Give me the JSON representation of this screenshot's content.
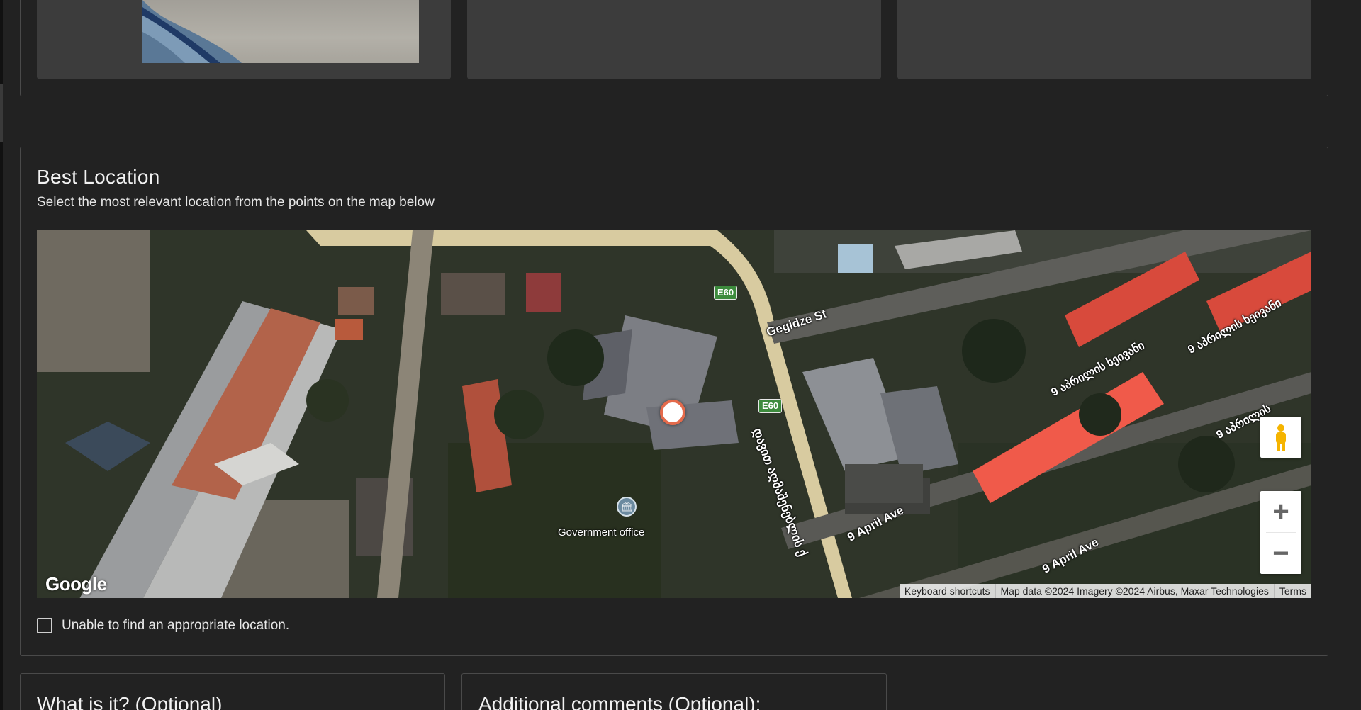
{
  "location_card": {
    "title": "Best Location",
    "subtitle": "Select the most relevant location from the points on the map below"
  },
  "map": {
    "labels": {
      "gegidze_st": "Gegidze St",
      "e60": "E60",
      "georgian_main_road": "დავით აღმაშენებლის ქ",
      "april_st_1": "9 აპრილის ხეივანი",
      "april_st_2": "9 აპრილის ხეივანი",
      "april_st_3": "9 აპრილის",
      "april_ave_1": "9 April Ave",
      "april_ave_2": "9 April Ave",
      "poi_government": "Government office"
    },
    "google_logo": "Google",
    "zoom_in": "+",
    "zoom_out": "−",
    "attribution": {
      "shortcuts": "Keyboard shortcuts",
      "data": "Map data ©2024 Imagery ©2024 Airbus, Maxar Technologies",
      "terms": "Terms"
    },
    "colors": {
      "pin_border": "#e46a4b",
      "road": "#d8cba0",
      "red_roofs": "#e04a3c"
    }
  },
  "unable_checkbox": {
    "label": "Unable to find an appropriate location.",
    "checked": false
  },
  "bottom_cards": {
    "what_is_it": "What is it? (Optional)",
    "comments": "Additional comments (Optional):"
  }
}
